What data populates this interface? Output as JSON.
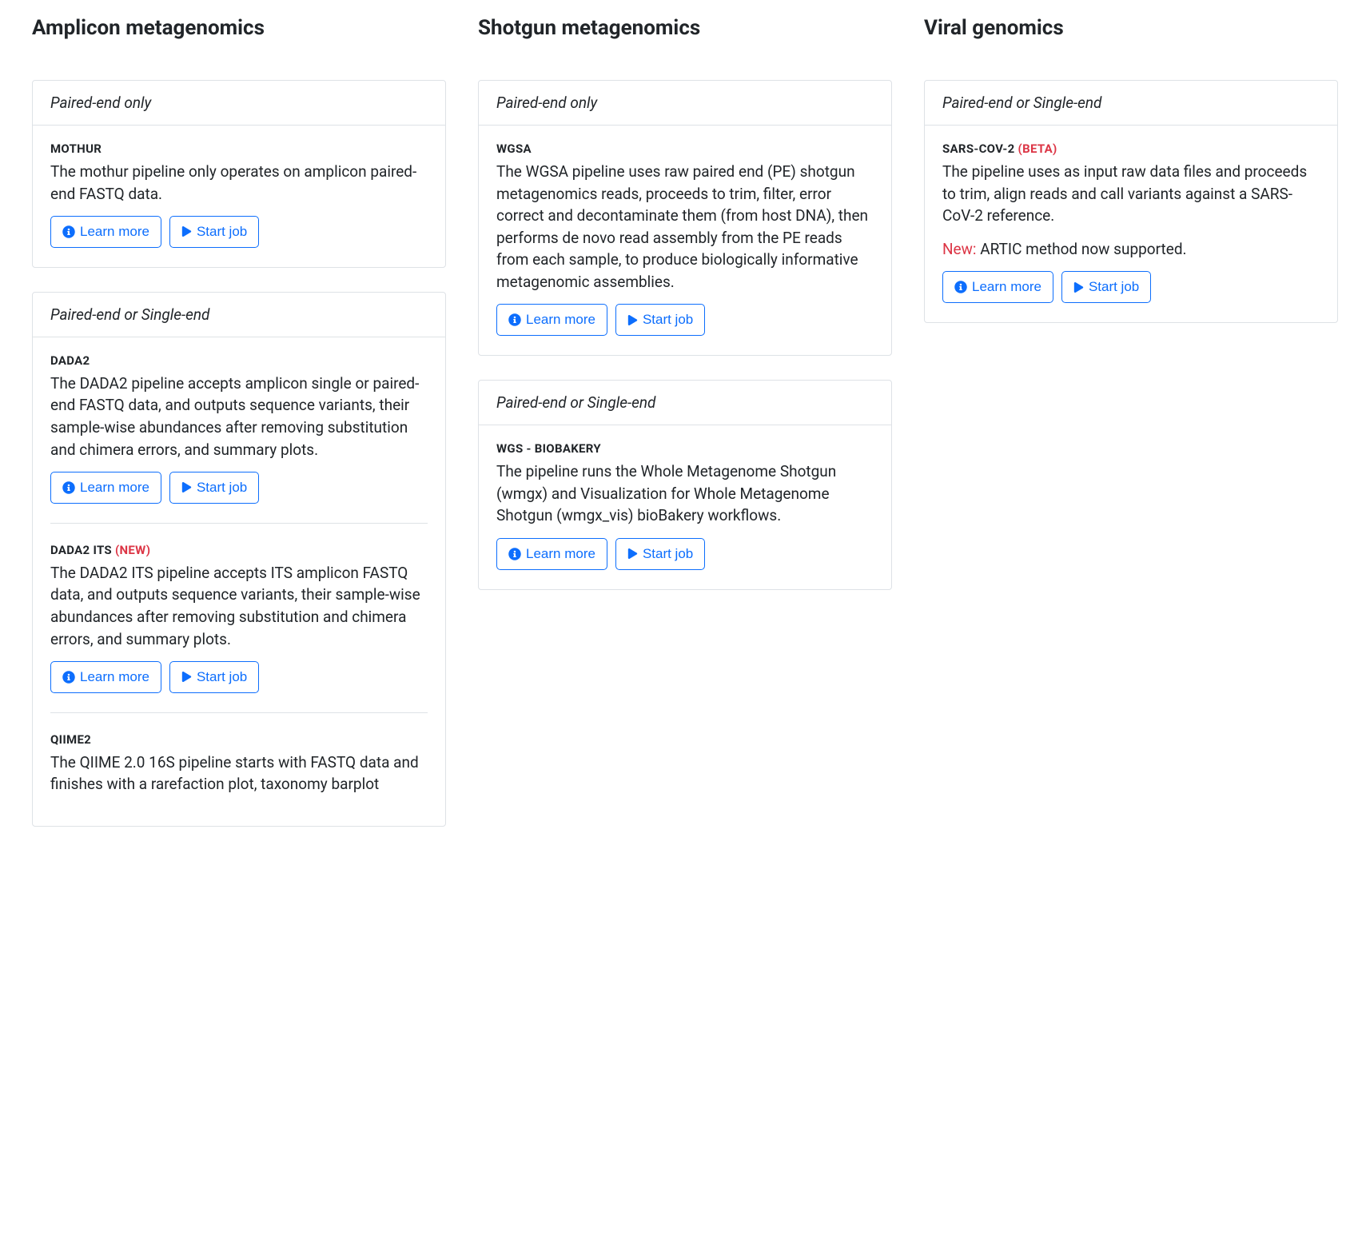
{
  "labels": {
    "learn_more": "Learn more",
    "start_job": "Start job"
  },
  "columns": [
    {
      "title": "Amplicon metagenomics",
      "cards": [
        {
          "header": "Paired-end only",
          "pipelines": [
            {
              "name": "MOTHUR",
              "tag": null,
              "desc": "The mothur pipeline only operates on amplicon paired-end FASTQ data.",
              "extra": null
            }
          ]
        },
        {
          "header": "Paired-end or Single-end",
          "pipelines": [
            {
              "name": "DADA2",
              "tag": null,
              "desc": "The DADA2 pipeline accepts amplicon single or paired-end FASTQ data, and outputs sequence variants, their sample-wise abundances after removing substitution and chimera errors, and summary plots.",
              "extra": null
            },
            {
              "name": "DADA2 ITS",
              "tag": "(NEW)",
              "desc": "The DADA2 ITS pipeline accepts ITS amplicon FASTQ data, and outputs sequence variants, their sample-wise abundances after removing substitution and chimera errors, and summary plots.",
              "extra": null
            },
            {
              "name": "QIIME2",
              "tag": null,
              "desc": "The QIIME 2.0 16S pipeline starts with FASTQ data and finishes with a rarefaction plot, taxonomy barplot",
              "extra": null,
              "hide_buttons": true
            }
          ]
        }
      ]
    },
    {
      "title": "Shotgun metagenomics",
      "cards": [
        {
          "header": "Paired-end only",
          "pipelines": [
            {
              "name": "WGSA",
              "tag": null,
              "desc": "The WGSA pipeline uses raw paired end (PE) shotgun metagenomics reads, proceeds to trim, filter, error correct and decontaminate them (from host DNA), then performs de novo read assembly from the PE reads from each sample, to produce biologically informative metagenomic assemblies.",
              "extra": null
            }
          ]
        },
        {
          "header": "Paired-end or Single-end",
          "pipelines": [
            {
              "name": "WGS - BIOBAKERY",
              "tag": null,
              "desc": "The pipeline runs the Whole Metagenome Shotgun (wmgx) and Visualization for Whole Metagenome Shotgun (wmgx_vis) bioBakery workflows.",
              "extra": null
            }
          ]
        }
      ]
    },
    {
      "title": "Viral genomics",
      "cards": [
        {
          "header": "Paired-end or Single-end",
          "pipelines": [
            {
              "name": "SARS-COV-2",
              "tag": "(BETA)",
              "desc": "The pipeline uses as input raw data files and proceeds to trim, align reads and call variants against a SARS-CoV-2 reference.",
              "extra": {
                "highlight": "New:",
                "text": " ARTIC method now supported."
              }
            }
          ]
        }
      ]
    }
  ]
}
